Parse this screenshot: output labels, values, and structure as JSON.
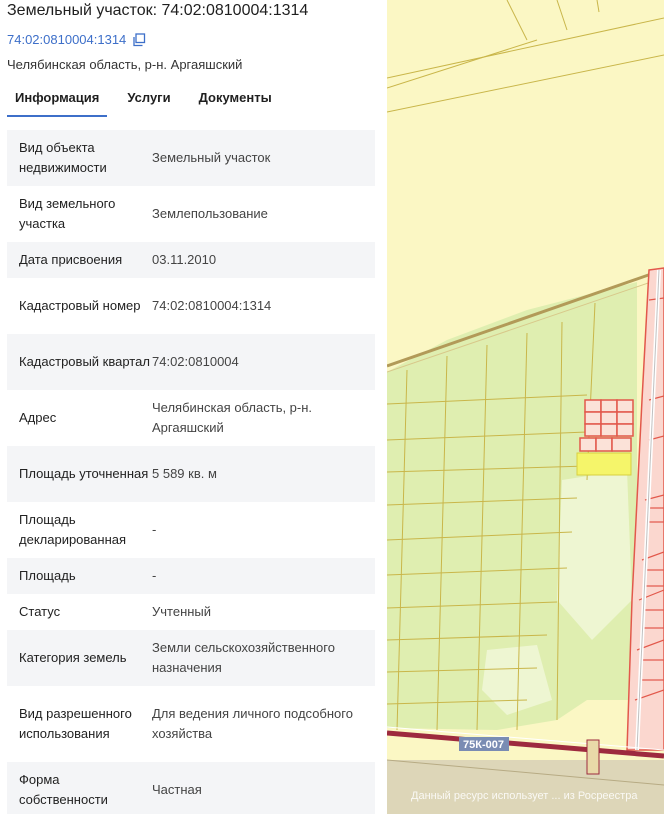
{
  "panel": {
    "title": "Земельный участок: 74:02:0810004:1314",
    "cadastral_link": "74:02:0810004:1314",
    "copy_icon": "copy-icon",
    "region": "Челябинская область, р-н. Аргаяшский",
    "tabs": [
      {
        "label": "Информация",
        "active": true
      },
      {
        "label": "Услуги",
        "active": false
      },
      {
        "label": "Документы",
        "active": false
      }
    ],
    "rows": [
      {
        "label": "Вид объекта недвижимости",
        "value": "Земельный участок"
      },
      {
        "label": "Вид земельного участка",
        "value": "Землепользование"
      },
      {
        "label": "Дата присвоения",
        "value": "03.11.2010"
      },
      {
        "label": "Кадастровый номер",
        "value": "74:02:0810004:1314"
      },
      {
        "label": "Кадастровый квартал",
        "value": "74:02:0810004"
      },
      {
        "label": "Адрес",
        "value": "Челябинская область, р-н. Аргаяшский"
      },
      {
        "label": "Площадь уточненная",
        "value": "5 589 кв. м"
      },
      {
        "label": "Площадь декларированная",
        "value": "-"
      },
      {
        "label": "Площадь",
        "value": "-"
      },
      {
        "label": "Статус",
        "value": "Учтенный"
      },
      {
        "label": "Категория земель",
        "value": "Земли сельскохозяйственного назначения"
      },
      {
        "label": "Вид разрешенного использования",
        "value": "Для ведения личного подсобного хозяйства"
      },
      {
        "label": "Форма собственности",
        "value": "Частная"
      }
    ]
  },
  "map": {
    "road_label": "75К-007",
    "credit": "Данный ресурс использует ... из Росреестра"
  },
  "colors": {
    "accent": "#3d6fc9",
    "map_background": "#fbf7c4",
    "forest": "#dfeeb0",
    "parcel_outline": "#c9b64a",
    "settlement_fill": "#fbd7cf",
    "settlement_outline": "#e2584b",
    "highlight": "#f5f56a",
    "road": "#9d2a3e"
  }
}
